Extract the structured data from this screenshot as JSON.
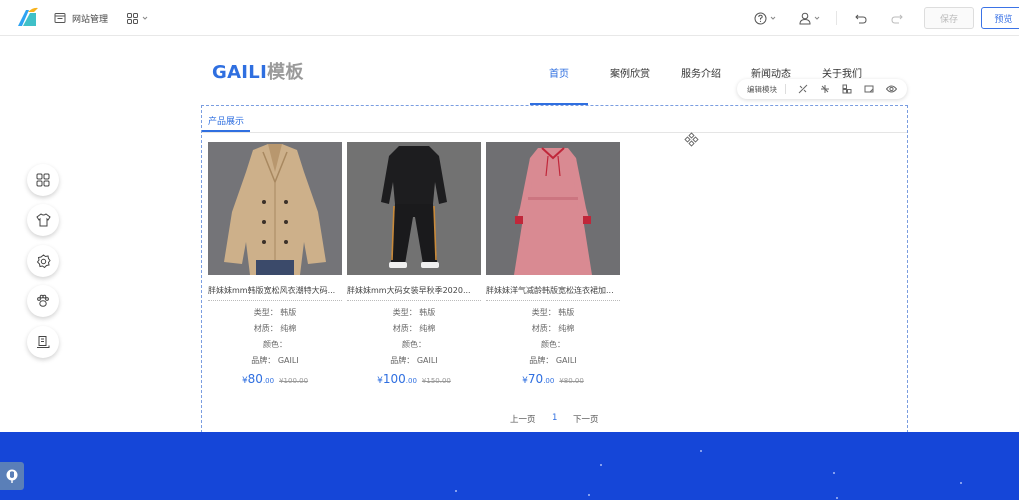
{
  "topbar": {
    "site_manage": "网站管理",
    "save_label": "保存",
    "preview_label": "预览"
  },
  "site": {
    "brand_part1": "GAILI",
    "brand_part2": "模板",
    "nav": [
      "首页",
      "案例欣赏",
      "服务介绍",
      "新闻动态",
      "关于我们"
    ],
    "active_nav": "首页"
  },
  "edit_toolbar": {
    "label": "编辑模块"
  },
  "module": {
    "title": "产品展示",
    "products": [
      {
        "name": "胖妹妹mm韩版宽松风衣潮特大码...",
        "type_label": "类型：",
        "type": "韩版",
        "material_label": "材质：",
        "material": "纯棉",
        "color_label": "颜色：",
        "color": "",
        "brand_label": "品牌：",
        "brand": "GAILI",
        "currency": "¥",
        "price_int": "80",
        "price_dec": ".00",
        "old_price": "¥100.00"
      },
      {
        "name": "胖妹妹mm大码女装早秋季2020...",
        "type_label": "类型：",
        "type": "韩版",
        "material_label": "材质：",
        "material": "纯棉",
        "color_label": "颜色：",
        "color": "",
        "brand_label": "品牌：",
        "brand": "GAILI",
        "currency": "¥",
        "price_int": "100",
        "price_dec": ".00",
        "old_price": "¥150.00"
      },
      {
        "name": "胖妹妹洋气减龄韩版宽松连衣裙加...",
        "type_label": "类型：",
        "type": "韩版",
        "material_label": "材质：",
        "material": "纯棉",
        "color_label": "颜色：",
        "color": "",
        "brand_label": "品牌：",
        "brand": "GAILI",
        "currency": "¥",
        "price_int": "70",
        "price_dec": ".00",
        "old_price": "¥80.00"
      }
    ],
    "pager": {
      "prev": "上一页",
      "current": "1",
      "next": "下一页"
    }
  },
  "colors": {
    "accent": "#2f6fe0",
    "footer": "#1546d8"
  }
}
